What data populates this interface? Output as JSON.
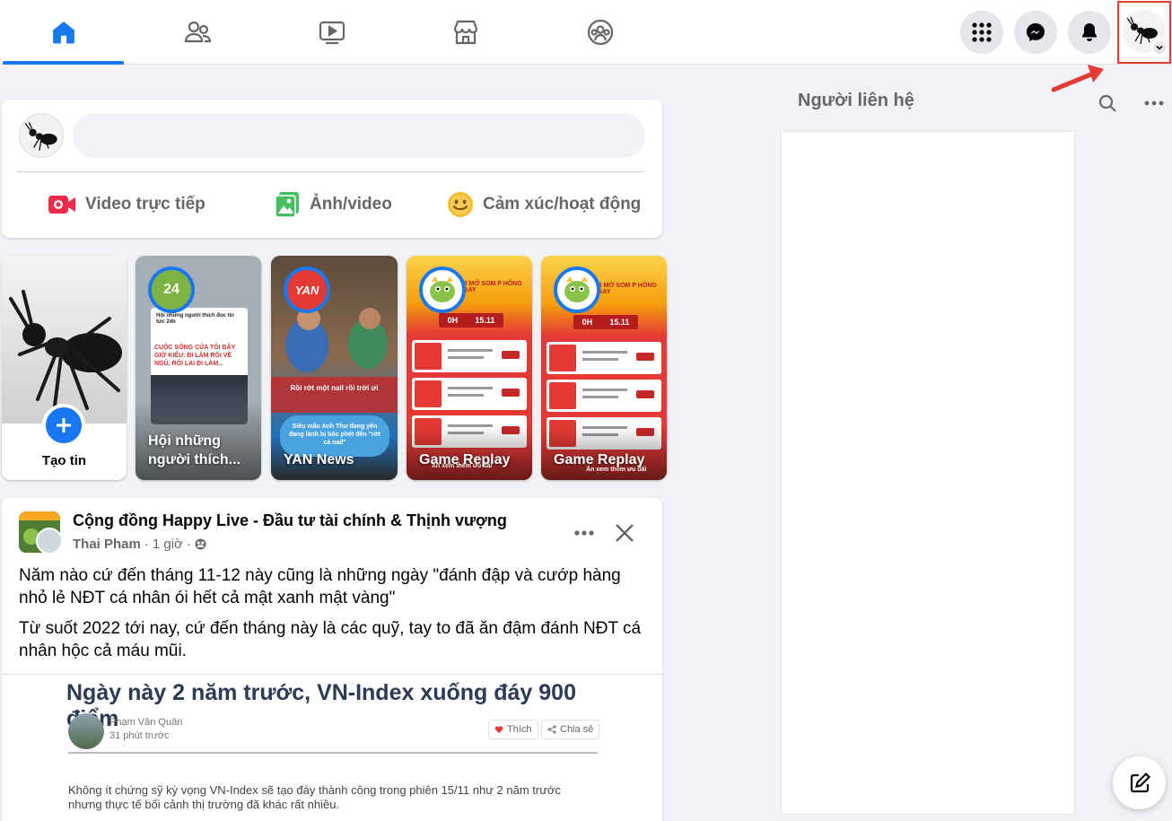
{
  "nav": {
    "tabs": [
      {
        "name": "home",
        "active": true
      },
      {
        "name": "friends",
        "active": false
      },
      {
        "name": "watch",
        "active": false
      },
      {
        "name": "marketplace",
        "active": false
      },
      {
        "name": "groups",
        "active": false
      }
    ]
  },
  "composer": {
    "actions": {
      "live": "Video trực tiếp",
      "photo": "Ảnh/video",
      "feeling": "Cảm xúc/hoạt động"
    }
  },
  "stories": {
    "create_label": "Tạo tin",
    "items": [
      {
        "title": "Hội những người thích..."
      },
      {
        "title": "YAN News"
      },
      {
        "title": "Game Replay"
      },
      {
        "title": "Game Replay"
      }
    ],
    "story1_card": {
      "header": "Hội những người thích đọc tin tức 24h",
      "banner": "CUỘC SỐNG CỦA TÔI BÂY GIỜ KIỂU: ĐI LÀM RỒI VỀ NGỦ, RỒI LẠI ĐI LÀM..."
    },
    "story2_caption": "Rồi rớt một nail rồi trời ơi",
    "story2_bubble": "Siêu mẫu Anh Thư đang yên đang lành bị bốc phét đến \"rớt cả nail\"",
    "promo_banner": "ER MỞ SOM P HỒNG NGAY",
    "promo_dates": [
      "0H",
      "15.11"
    ],
    "promo_footer": "Ấn xem thêm ưu đãi"
  },
  "post": {
    "group_name": "Cộng đồng Happy Live - Đầu tư tài chính & Thịnh vượng",
    "author": "Thai Pham",
    "time": "1 giờ",
    "paragraph1": "Năm nào cứ đến tháng 11-12 này cũng là những ngày \"đánh đập và cướp hàng nhỏ lẻ NĐT cá nhân ói hết cả mật xanh mật vàng\"",
    "paragraph2": "Từ suốt 2022 tới nay, cứ đến tháng này là các quỹ, tay to đã ăn đậm đánh NĐT cá nhân hộc cả máu mũi.",
    "article": {
      "headline": "Ngày này 2 năm trước, VN-Index xuống đáy 900 điểm",
      "author": "Phạm Văn Quân",
      "time": "31 phút trước",
      "like_label": "Thích",
      "share_label": "Chia sẻ",
      "body": "Không ít chứng sỹ kỳ vọng VN-Index sẽ tạo đáy thành công trong phiên 15/11 như 2 năm trước nhưng thực tế bối cảnh thị trường đã khác rất nhiều."
    }
  },
  "contacts": {
    "title": "Người liên hệ"
  },
  "colors": {
    "accent": "#1877f2",
    "highlight": "#e53935",
    "background": "#f0f2f5"
  }
}
